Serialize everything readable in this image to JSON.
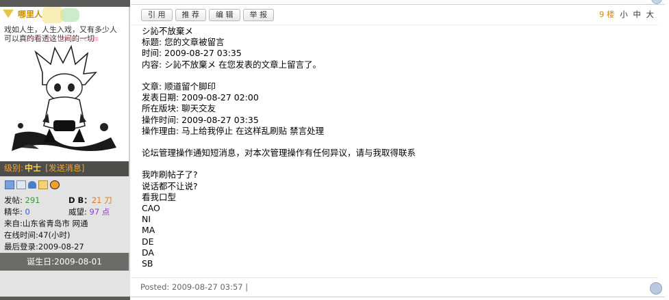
{
  "sidebar": {
    "logo_text": "哪里人",
    "watermark": "bbs.houdao.com",
    "signature_line1": "戏如人生，人生入戏，又有多少人",
    "signature_line2": "可以真的看透这世间的一切",
    "rank_label": "级别:",
    "rank_value": "中士",
    "send_message": "[发送消息]",
    "icons": [
      "profile-card-icon",
      "document-icon",
      "add-friend-icon",
      "mailbox-icon",
      "qq-icon"
    ],
    "stats": {
      "posts_label": "发帖:",
      "posts_value": "291",
      "db_label": "D B：",
      "db_value": "21 刀",
      "essence_label": "精华:",
      "essence_value": "0",
      "prestige_label": "威望:",
      "prestige_value": "97 点",
      "from": "来自:山东省青岛市 网通",
      "online": "在线时间:47(小时)",
      "last_login": "最后登录:2009-08-27"
    },
    "birthday": "诞生日:2009-08-01"
  },
  "post": {
    "buttons": [
      "引 用",
      "推 荐",
      "编 辑",
      "举 报"
    ],
    "floor_number": "9 楼",
    "font_sizes": [
      "小",
      "中",
      "大"
    ],
    "lines": [
      "シ訫不放棄メ",
      "标题: 您的文章被留言",
      "时间: 2009-08-27 03:35",
      "内容: シ訫不放棄メ 在您发表的文章上留言了。",
      "",
      "文章: 顺道留个脚印",
      "发表日期: 2009-08-27 02:00",
      "所在版块: 聊天交友",
      "操作时间: 2009-08-27 03:35",
      "操作理由: 马上给我停止  在这样乱刷贴  禁言处理",
      "",
      "论坛管理操作通知短消息，对本次管理操作有任何异议，请与我取得联系",
      "",
      "我咋刷帖子了?",
      "说话都不让说?",
      "看我口型",
      "CAO",
      "NI",
      "MA",
      "DE",
      "DA",
      "SB"
    ],
    "posted": "Posted: 2009-08-27 03:57 |"
  },
  "colors": {
    "sidebar_bg": "#e3e3e3",
    "sidebar_dark": "#4d4d4b",
    "rank_text": "#f1a53a",
    "floor_number": "#d78b1a"
  }
}
